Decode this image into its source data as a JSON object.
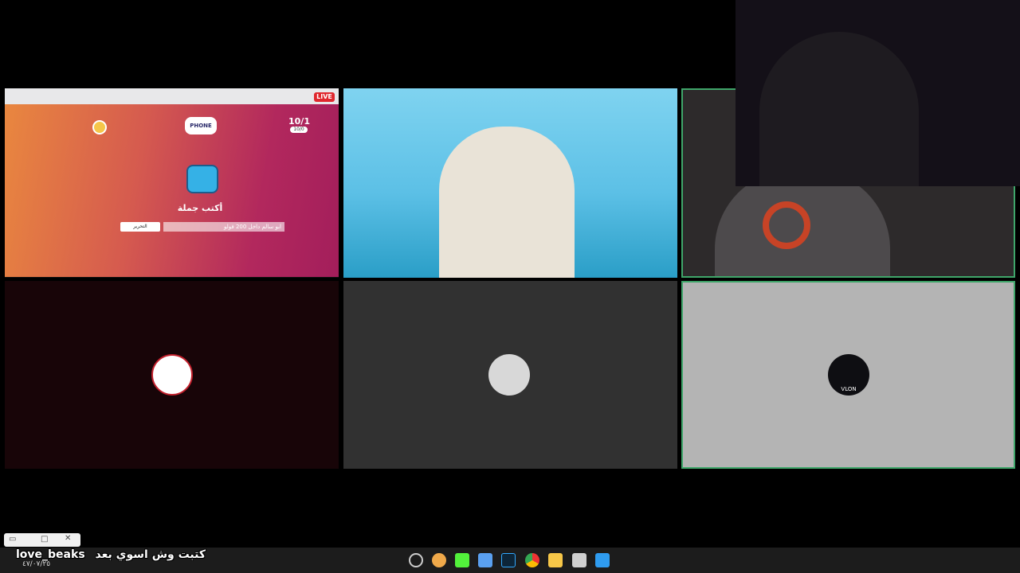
{
  "screenshare": {
    "live_badge": "LIVE",
    "game": {
      "logo": "PHONE",
      "round": "10/1",
      "round_sub": "10/0",
      "heading": "أكتب جملة",
      "input_value": "ابو سالم داخل 200 فولو",
      "submit_label": "التحرير"
    }
  },
  "participants": [
    {
      "id": "screenshare",
      "type": "screenshare"
    },
    {
      "id": "cam2",
      "type": "camera"
    },
    {
      "id": "cam3",
      "type": "camera"
    },
    {
      "id": "avatar1",
      "type": "avatar",
      "color": "#c2202c"
    },
    {
      "id": "avatar2",
      "type": "avatar",
      "color": "#d8d8d8"
    },
    {
      "id": "avatar3",
      "type": "avatar",
      "label": "VLON"
    }
  ],
  "overlay": {
    "username": "love_beaks",
    "caption": "كتبت وش اسوي بعد",
    "date": "٤٧/٠٧/٢٥"
  },
  "taskbar": {
    "icons": [
      "obs-icon",
      "discord-icon",
      "kick-icon",
      "notepad-icon",
      "photoshop-icon",
      "chrome-icon",
      "folder-icon",
      "app-icon",
      "windows-icon"
    ]
  }
}
